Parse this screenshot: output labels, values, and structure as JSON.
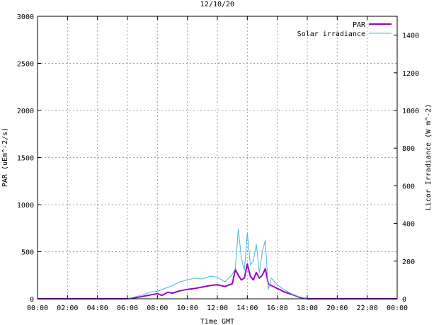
{
  "chart_data": {
    "type": "line",
    "title": "12/10/20",
    "xlabel": "Time GMT",
    "ylabel": "PAR (uEm^-2/s)",
    "y2label": "Licor Irradiance (W m^-2)",
    "x_tick_labels": [
      "00:00",
      "02:00",
      "04:00",
      "06:00",
      "08:00",
      "10:00",
      "12:00",
      "14:00",
      "16:00",
      "18:00",
      "20:00",
      "22:00",
      "00:00"
    ],
    "xlim": [
      0,
      24
    ],
    "ylim": [
      0,
      3000
    ],
    "y_ticks": [
      0,
      500,
      1000,
      1500,
      2000,
      2500,
      3000
    ],
    "y2lim": [
      0,
      1500
    ],
    "y2_ticks": [
      0,
      200,
      400,
      600,
      800,
      1000,
      1200,
      1400
    ],
    "grid": true,
    "legend_position": "top-right",
    "series": [
      {
        "name": "PAR",
        "axis": "left",
        "color": "#9400d3",
        "x": [
          0,
          6.0,
          6.5,
          7.0,
          7.5,
          8.0,
          8.3,
          8.7,
          9.0,
          9.5,
          10.0,
          10.5,
          11.0,
          11.5,
          12.0,
          12.5,
          13.0,
          13.2,
          13.4,
          13.6,
          13.8,
          14.0,
          14.2,
          14.4,
          14.6,
          14.8,
          15.0,
          15.2,
          15.4,
          15.6,
          16.0,
          16.5,
          17.0,
          17.5,
          18.0,
          24
        ],
        "values": [
          0,
          0,
          10,
          25,
          40,
          55,
          35,
          70,
          60,
          85,
          100,
          110,
          125,
          140,
          150,
          130,
          160,
          310,
          250,
          200,
          220,
          370,
          240,
          200,
          280,
          220,
          250,
          320,
          160,
          140,
          110,
          70,
          45,
          15,
          0,
          0
        ]
      },
      {
        "name": "Solar irradiance",
        "axis": "right",
        "color": "#4ab4dc",
        "x": [
          0,
          6.0,
          6.5,
          7.0,
          7.5,
          8.0,
          8.5,
          9.0,
          9.5,
          10.0,
          10.5,
          11.0,
          11.5,
          12.0,
          12.5,
          13.0,
          13.2,
          13.4,
          13.6,
          13.8,
          14.0,
          14.2,
          14.4,
          14.6,
          14.8,
          15.0,
          15.2,
          15.4,
          15.6,
          16.0,
          16.5,
          17.0,
          17.5,
          18.0,
          24
        ],
        "values": [
          0,
          0,
          10,
          20,
          35,
          40,
          55,
          70,
          90,
          100,
          110,
          105,
          120,
          115,
          90,
          130,
          160,
          370,
          220,
          150,
          350,
          180,
          200,
          290,
          140,
          250,
          310,
          50,
          110,
          75,
          45,
          25,
          10,
          0,
          0
        ]
      }
    ]
  }
}
